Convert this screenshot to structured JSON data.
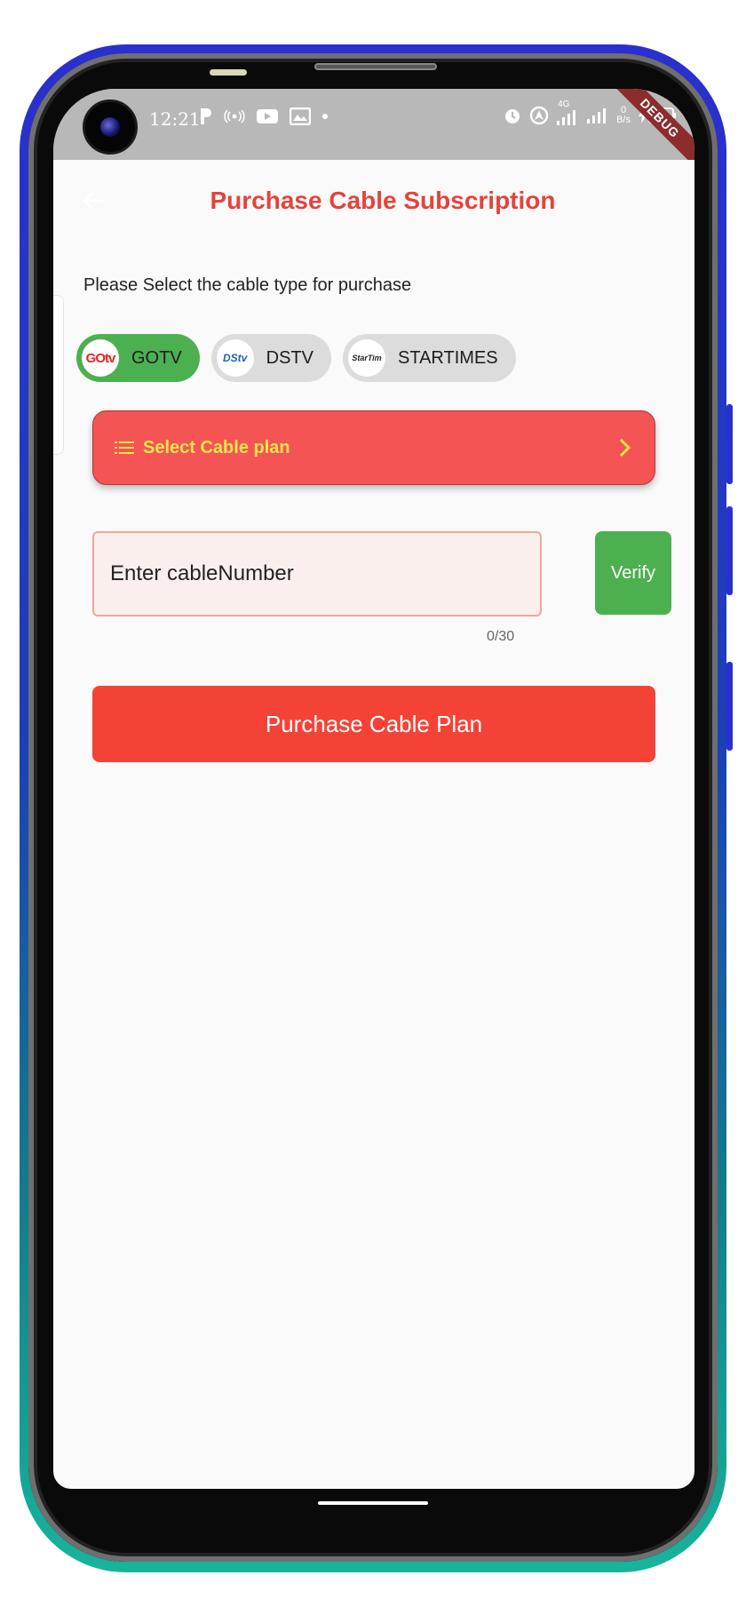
{
  "status_bar": {
    "time": "12:21",
    "network_gen": "4G",
    "net_speed_value": "0",
    "net_speed_unit": "B/s",
    "battery": "94",
    "debug_label": "DEBUG",
    "icons_left": [
      "parking-icon",
      "hotspot-icon",
      "youtube-icon",
      "gallery-icon",
      "dot-icon"
    ],
    "icons_right": [
      "alarm-icon",
      "location-icon",
      "signal-icon",
      "signal-icon",
      "battery-icon"
    ]
  },
  "appbar": {
    "title": "Purchase Cable Subscription",
    "title_color": "#e5433a"
  },
  "instruction": "Please Select the cable type for purchase",
  "cable_types": [
    {
      "label": "GOTV",
      "logo": "GOtv",
      "selected": true
    },
    {
      "label": "DSTV",
      "logo": "DStv",
      "selected": false
    },
    {
      "label": "STARTIMES",
      "logo": "StarTim",
      "selected": false
    }
  ],
  "select_plan": {
    "label": "Select Cable plan"
  },
  "cable_number": {
    "placeholder": "Enter cableNumber",
    "value": "",
    "counter": "0/30"
  },
  "verify_label": "Verify",
  "purchase_label": "Purchase Cable Plan",
  "colors": {
    "accent_red": "#f44336",
    "selected_green": "#4cb050",
    "plan_text_yellow": "#f8e64a"
  }
}
